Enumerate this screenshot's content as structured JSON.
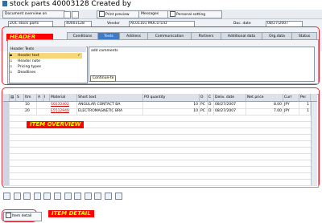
{
  "window": {
    "title": "stock parts 40003128 Created by"
  },
  "toolbar": {
    "buttons": [
      {
        "label": "Document overview on"
      },
      {
        "label": "Print preview"
      },
      {
        "label": "Messages"
      },
      {
        "label": "Personal setting"
      }
    ]
  },
  "header": {
    "doc_type_value": "ZOC stock parts",
    "doc_number_value": "40003128",
    "vendor_label": "Vendor",
    "vendor_value": "AC01101 MOCO LTD",
    "doc_date_label": "Doc. date",
    "doc_date_value": "08/27/2007",
    "annotation": "HEADER"
  },
  "tabs": [
    {
      "label": "Conditions"
    },
    {
      "label": "Texts"
    },
    {
      "label": "Address"
    },
    {
      "label": "Communication"
    },
    {
      "label": "Partners"
    },
    {
      "label": "Additional data"
    },
    {
      "label": "Org.data"
    },
    {
      "label": "Status"
    }
  ],
  "texts_panel": {
    "tree_header": "Header Texts",
    "items": [
      {
        "label": "Header text"
      },
      {
        "label": "Header note"
      },
      {
        "label": "Pricing types"
      },
      {
        "label": "Deadlines"
      }
    ],
    "text_value": "add comments",
    "continue_label": "Continue-te"
  },
  "items_table": {
    "annotation": "ITEM OVERVIEW",
    "columns": [
      "Itm",
      "A",
      "I",
      "Material",
      "Short text",
      "PO quantity",
      "O",
      "C",
      "Deliv. date",
      "Net price",
      "Curr",
      "Per"
    ],
    "rows": [
      {
        "itm": "10",
        "material": "S0232402",
        "short_text": "ANGULAR CONTACT BA",
        "qty": "10",
        "o": "PC",
        "c": "D",
        "deliv": "08/27/2007",
        "price": "8.00",
        "curr": "JPY",
        "per": "1"
      },
      {
        "itm": "20",
        "material": "E5512940",
        "short_text": "ELECTROMAGNETIC BRA",
        "qty": "10",
        "o": "PC",
        "c": "D",
        "deliv": "08/27/2007",
        "price": "7.00",
        "curr": "JPY",
        "per": "1"
      }
    ]
  },
  "item_detail": {
    "button_label": "Item detail",
    "annotation": "ITEM DETAIL"
  },
  "colors": {
    "annotation_red": "#ff0000",
    "annotation_text": "#ffff00",
    "tab_active": "#3f7bc7"
  }
}
